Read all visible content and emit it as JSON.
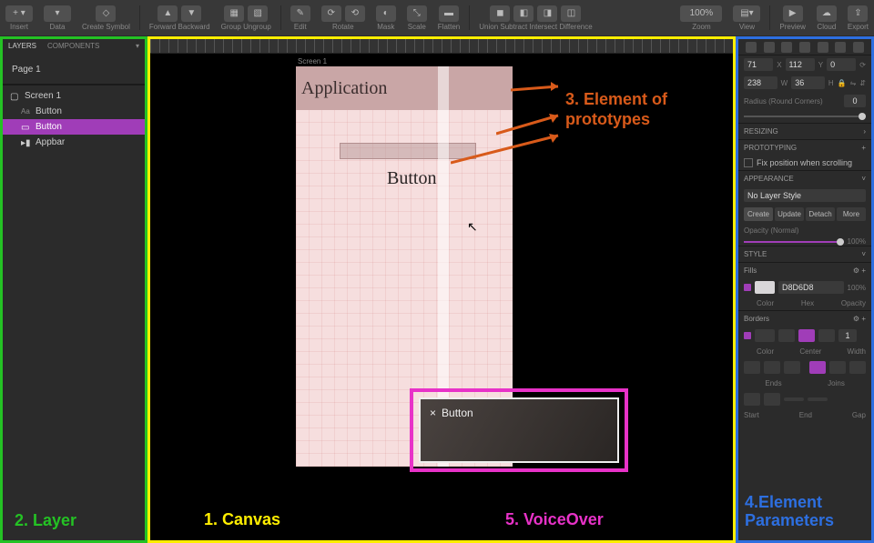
{
  "toolbar": {
    "insert": "Insert",
    "data": "Data",
    "create_symbol": "Create Symbol",
    "forward": "Forward",
    "backward": "Backward",
    "group": "Group",
    "ungroup": "Ungroup",
    "edit": "Edit",
    "rotate": "Rotate",
    "mask": "Mask",
    "scale": "Scale",
    "flatten": "Flatten",
    "union": "Union",
    "subtract": "Subtract",
    "intersect": "Intersect",
    "difference": "Difference",
    "zoom": "Zoom",
    "zoom_value": "100%",
    "view": "View",
    "preview": "Preview",
    "cloud": "Cloud",
    "export": "Export"
  },
  "left_panel": {
    "tab_layers": "LAYERS",
    "tab_components": "COMPONENTS",
    "page": "Page 1",
    "layers": {
      "screen": "Screen 1",
      "button1": "Button",
      "button2": "Button",
      "appbar": "Appbar"
    }
  },
  "canvas": {
    "artboard_label": "Screen 1",
    "appbar_text": "Application",
    "button_text": "Button"
  },
  "voiceover": {
    "close": "×",
    "text": "Button"
  },
  "right_panel": {
    "x": "71",
    "y": "112",
    "rot": "0",
    "w": "238",
    "h": "36",
    "radius_label": "Radius (Round Corners)",
    "radius": "0",
    "resizing": "RESIZING",
    "prototyping": "PROTOTYPING",
    "fix_pos": "Fix position when scrolling",
    "appearance": "APPEARANCE",
    "no_style": "No Layer Style",
    "create": "Create",
    "update": "Update",
    "detach": "Detach",
    "more": "More",
    "opacity_label": "Opacity (Normal)",
    "opacity": "100%",
    "style": "STYLE",
    "fills": "Fills",
    "fill_hex": "D8D6D8",
    "fill_opacity": "100%",
    "fill_color": "Color",
    "fill_hex_label": "Hex",
    "fill_op_label": "Opacity",
    "borders": "Borders",
    "border_color": "Color",
    "border_center": "Center",
    "border_width_label": "Width",
    "border_width": "1",
    "ends": "Ends",
    "joins": "Joins",
    "start": "Start",
    "end": "End",
    "gap": "Gap"
  },
  "annotations": {
    "canvas": "1. Canvas",
    "layer": "2. Layer",
    "elements": "3. Element of prototypes",
    "params": "4.Element Parameters",
    "voiceover": "5. VoiceOver"
  },
  "colors": {
    "green": "#24c224",
    "yellow": "#ffee00",
    "orange": "#d85a1a",
    "blue": "#2d6fe0",
    "magenta": "#e832c8"
  }
}
